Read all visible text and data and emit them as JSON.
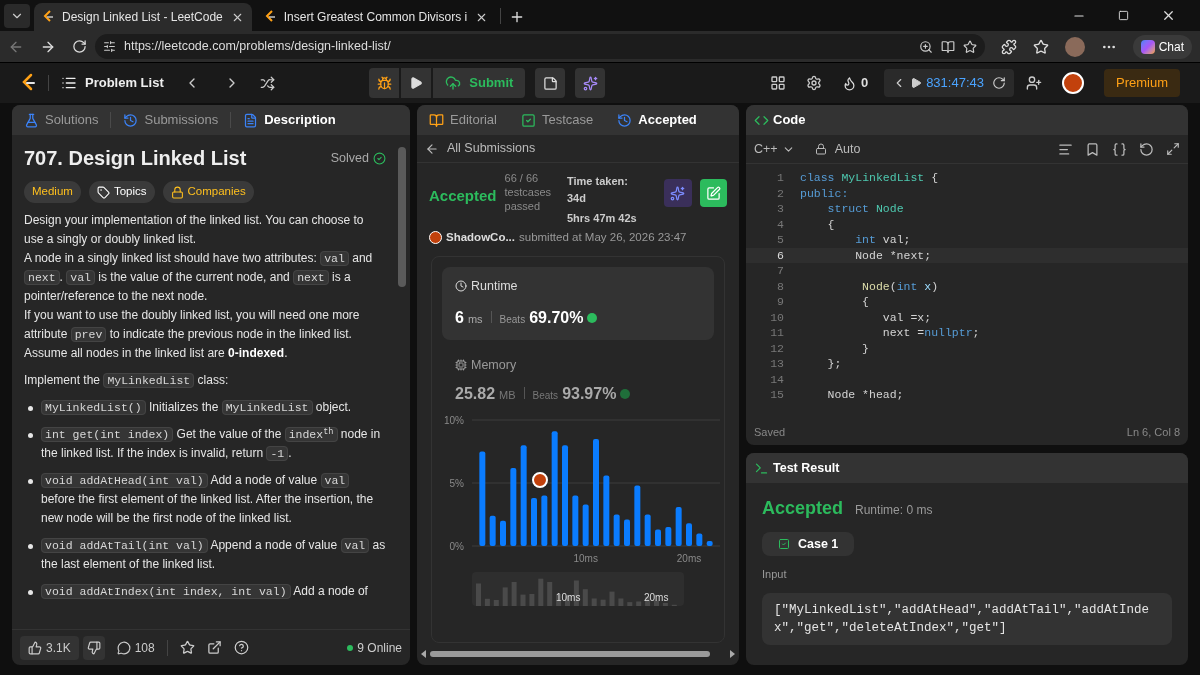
{
  "browser": {
    "tabs": [
      {
        "title": "Design Linked List - LeetCode",
        "selected": true
      },
      {
        "title": "Insert Greatest Common Divisors i",
        "selected": false
      }
    ],
    "url": "https://leetcode.com/problems/design-linked-list/",
    "chat": "Chat"
  },
  "navbar": {
    "problem_list": "Problem List",
    "submit": "Submit",
    "streak": "0",
    "timer": "831:47:43",
    "premium": "Premium"
  },
  "description_panel": {
    "tabs": [
      {
        "label": "Solutions",
        "kind": "solutions",
        "selected": false
      },
      {
        "label": "Submissions",
        "kind": "submissions",
        "selected": false
      },
      {
        "label": "Description",
        "kind": "description",
        "selected": true
      }
    ],
    "title": "707. Design Linked List",
    "status": "Solved",
    "tags": [
      {
        "label": "Medium",
        "kind": "difficulty"
      },
      {
        "label": "Topics",
        "kind": "topics"
      },
      {
        "label": "Companies",
        "kind": "companies"
      }
    ],
    "blocks": [
      {
        "kind": "text",
        "lines": [
          [
            {
              "kind": "text",
              "text": "Design your implementation of the linked list. You can choose to use a singly or doubly linked list."
            }
          ],
          [
            {
              "kind": "text",
              "text": "A node in a singly linked list should have two attributes: "
            },
            {
              "kind": "code",
              "text": "val"
            },
            {
              "kind": "text",
              "text": " and "
            },
            {
              "kind": "code",
              "text": "next"
            },
            {
              "kind": "text",
              "text": ". "
            },
            {
              "kind": "code",
              "text": "val"
            },
            {
              "kind": "text",
              "text": " is the value of the current node, and "
            },
            {
              "kind": "code",
              "text": "next"
            },
            {
              "kind": "text",
              "text": " is a pointer/reference to the next node."
            }
          ],
          [
            {
              "kind": "text",
              "text": "If you want to use the doubly linked list, you will need one more attribute "
            },
            {
              "kind": "code",
              "text": "prev"
            },
            {
              "kind": "text",
              "text": " to indicate the previous node in the linked list. Assume all nodes in the linked list are "
            },
            {
              "kind": "bold",
              "text": "0-indexed"
            },
            {
              "kind": "text",
              "text": "."
            }
          ]
        ]
      },
      {
        "kind": "text",
        "lines": [
          [
            {
              "kind": "text",
              "text": "Implement the "
            },
            {
              "kind": "code",
              "text": "MyLinkedList"
            },
            {
              "kind": "text",
              "text": " class:"
            }
          ]
        ]
      },
      {
        "kind": "bullet",
        "lines": [
          [
            {
              "kind": "code",
              "text": "MyLinkedList()"
            },
            {
              "kind": "text",
              "text": " Initializes the "
            },
            {
              "kind": "code",
              "text": "MyLinkedList"
            },
            {
              "kind": "text",
              "text": " object."
            }
          ]
        ]
      },
      {
        "kind": "bullet",
        "lines": [
          [
            {
              "kind": "code",
              "text": "int get(int index)"
            },
            {
              "kind": "text",
              "text": " Get the value of the "
            },
            {
              "kind": "code",
              "text": "index$^{th}$"
            },
            {
              "kind": "text",
              "text": " node in the linked list. If the index is invalid, return "
            },
            {
              "kind": "code",
              "text": "-1"
            },
            {
              "kind": "text",
              "text": "."
            }
          ]
        ]
      },
      {
        "kind": "bullet",
        "lines": [
          [
            {
              "kind": "code",
              "text": "void addAtHead(int val)"
            },
            {
              "kind": "text",
              "text": " Add a node of value "
            },
            {
              "kind": "code",
              "text": "val"
            },
            {
              "kind": "text",
              "text": " before the first element of the linked list. After the insertion, the new node will be the first node of the linked list."
            }
          ]
        ]
      },
      {
        "kind": "bullet",
        "lines": [
          [
            {
              "kind": "code",
              "text": "void addAtTail(int val)"
            },
            {
              "kind": "text",
              "text": " Append a node of value "
            },
            {
              "kind": "code",
              "text": "val"
            },
            {
              "kind": "text",
              "text": " as the last element of the linked list."
            }
          ]
        ]
      },
      {
        "kind": "bullet",
        "lines": [
          [
            {
              "kind": "code",
              "text": "void addAtIndex(int index, int val)"
            },
            {
              "kind": "text",
              "text": " Add a node of"
            }
          ]
        ]
      }
    ],
    "footer": {
      "likes": "3.1K",
      "comments": "108",
      "online": "9 Online"
    }
  },
  "submission_panel": {
    "tabs": [
      {
        "label": "Editorial",
        "kind": "editorial",
        "selected": false
      },
      {
        "label": "Testcase",
        "kind": "testcase",
        "selected": false
      },
      {
        "label": "Accepted",
        "kind": "result",
        "selected": true
      }
    ],
    "back_link": "All Submissions",
    "status": "Accepted",
    "testcases": [
      "66 / 66",
      "testcases",
      "passed"
    ],
    "time_taken": [
      "Time taken: 34d",
      "5hrs 47m 42s"
    ],
    "user": "ShadowCo...",
    "submitted": "submitted at May 26, 2026 23:47",
    "runtime": {
      "title": "Runtime",
      "value": "6",
      "unit": "ms",
      "beats_label": "Beats",
      "beats": "69.70%"
    },
    "memory": {
      "title": "Memory",
      "value": "25.82",
      "unit": "MB",
      "beats_label": "Beats",
      "beats": "93.97%",
      "chart_data": {
        "type": "bar",
        "x": [
          0,
          1,
          2,
          3,
          4,
          5,
          6,
          7,
          8,
          9,
          10,
          11,
          12,
          13,
          14,
          15,
          16,
          17,
          18,
          19,
          20,
          21,
          22
        ],
        "series": [
          {
            "color": "#0a7cff",
            "values": [
              7.5,
              2.4,
              2.0,
              6.2,
              8.0,
              3.8,
              4.0,
              9.1,
              8.0,
              4.0,
              3.3,
              8.5,
              5.6,
              2.5,
              2.1,
              4.8,
              2.5,
              1.3,
              1.5,
              3.1,
              1.8,
              1.0,
              0.4
            ]
          }
        ],
        "xlim": [
          -1,
          23
        ],
        "ylim": [
          0,
          10
        ],
        "xticks": [
          {
            "value": 10,
            "label": "10ms"
          },
          {
            "value": 20,
            "label": "20ms"
          }
        ],
        "yticks": [
          {
            "value": 0,
            "label": "0%"
          },
          {
            "value": 5,
            "label": "5%"
          },
          {
            "value": 10,
            "label": "10%"
          }
        ]
      },
      "marker": {
        "kind": "avatar"
      },
      "navigator_ticks": [
        "10ms",
        "20ms"
      ]
    }
  },
  "code_panel": {
    "title": "Code",
    "language": "C++",
    "mode": "Auto",
    "lines": [
      {
        "number": "1",
        "current": false,
        "tokens": [
          {
            "kind": "keyword",
            "text": "class "
          },
          {
            "kind": "type",
            "text": "MyLinkedList"
          },
          {
            "kind": "plain",
            "text": " {"
          }
        ]
      },
      {
        "number": "2",
        "current": false,
        "tokens": [
          {
            "kind": "keyword",
            "text": "public:"
          }
        ]
      },
      {
        "number": "3",
        "current": false,
        "tokens": [
          {
            "kind": "keyword",
            "text": "    struct "
          },
          {
            "kind": "type",
            "text": "Node"
          }
        ]
      },
      {
        "number": "4",
        "current": false,
        "tokens": [
          {
            "kind": "plain",
            "text": "    {"
          }
        ]
      },
      {
        "number": "5",
        "current": false,
        "tokens": [
          {
            "kind": "keyword",
            "text": "        int"
          },
          {
            "kind": "plain",
            "text": " val;"
          }
        ]
      },
      {
        "number": "6",
        "current": true,
        "tokens": [
          {
            "kind": "plain",
            "text": "        Node *next;"
          }
        ]
      },
      {
        "number": "7",
        "current": false
      },
      {
        "number": "8",
        "current": false,
        "tokens": [
          {
            "kind": "function",
            "text": "         Node"
          },
          {
            "kind": "plain",
            "text": "("
          },
          {
            "kind": "keyword",
            "text": "int "
          },
          {
            "kind": "variable",
            "text": "x"
          },
          {
            "kind": "plain",
            "text": ")"
          }
        ]
      },
      {
        "number": "9",
        "current": false,
        "tokens": [
          {
            "kind": "plain",
            "text": "         {"
          }
        ]
      },
      {
        "number": "10",
        "current": false,
        "tokens": [
          {
            "kind": "plain",
            "text": "            val =x;"
          }
        ]
      },
      {
        "number": "11",
        "current": false,
        "tokens": [
          {
            "kind": "plain",
            "text": "            next ="
          },
          {
            "kind": "keyword",
            "text": "nullptr"
          },
          {
            "kind": "plain",
            "text": ";"
          }
        ]
      },
      {
        "number": "12",
        "current": false,
        "tokens": [
          {
            "kind": "plain",
            "text": "         }"
          }
        ]
      },
      {
        "number": "13",
        "current": false,
        "tokens": [
          {
            "kind": "plain",
            "text": "    };"
          }
        ]
      },
      {
        "number": "14",
        "current": false
      },
      {
        "number": "15",
        "current": false,
        "tokens": [
          {
            "kind": "plain",
            "text": "    Node *head;"
          }
        ]
      }
    ],
    "saved": "Saved",
    "cursor": "Ln 6, Col 8"
  },
  "test_result": {
    "title": "Test Result",
    "status": "Accepted",
    "runtime": "Runtime: 0 ms",
    "case": "Case 1",
    "input_label": "Input",
    "input": "[\"MyLinkedList\",\"addAtHead\",\"addAtTail\",\"addAtIndex\",\"get\",\"deleteAtIndex\",\"get\"]"
  }
}
